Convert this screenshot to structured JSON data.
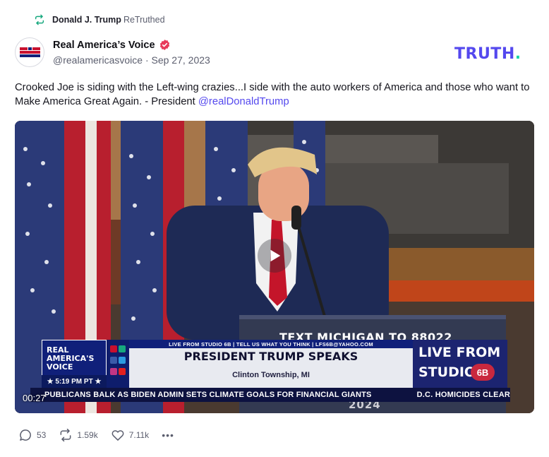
{
  "retruth": {
    "user": "Donald J. Trump",
    "action": "ReTruthed",
    "icon": "retruth-icon"
  },
  "post": {
    "author_name": "Real America’s Voice",
    "verified_icon": "verified-badge-icon",
    "handle": "@realamericasvoice",
    "separator": "·",
    "date": "Sep 27, 2023",
    "text_before": "Crooked Joe is siding with the Left-wing crazies...I side with the auto workers of America and those who want to Make America Great Again. - President ",
    "mention": "@realDonaldTrump",
    "avatar_text": "REAL AMERICA'S VOICE"
  },
  "brand": {
    "logo_text": "TRUTH",
    "logo_dot": ".",
    "primary_color": "#5448ee",
    "accent_color": "#17d4a8"
  },
  "video": {
    "timecode": "00:27",
    "play_icon": "play-icon",
    "podium_text": "TEXT MICHIGAN TO 88022",
    "podium_year": "2024",
    "lower_third": {
      "logo_text": "REAL AMERICA'S VOICE",
      "time": "★ 5:19 PM PT ★",
      "ticker_top": "LIVE FROM STUDIO 6B | TELL US WHAT YOU THINK | LFS6B@YAHOO.COM",
      "headline": "PRESIDENT TRUMP SPEAKS",
      "location": "Clinton Township, MI",
      "live_text_line1": "LIVE FROM",
      "live_text_line2": "STUDIO",
      "live_badge": "6B",
      "crawl_left": "PUBLICANS BALK AS BIDEN ADMIN SETS CLIMATE GOALS FOR FINANCIAL GIANTS",
      "crawl_right": "D.C. HOMICIDES CLEAR"
    }
  },
  "actions": {
    "replies": "53",
    "retruths": "1.59k",
    "likes": "7.11k",
    "more": "•••"
  }
}
